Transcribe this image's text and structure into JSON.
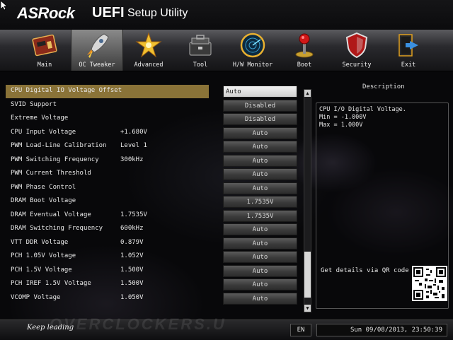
{
  "header": {
    "brand": "ASRock",
    "uefi": "UEFI",
    "title": "Setup Utility"
  },
  "tabs": [
    {
      "label": "Main",
      "icon": "main-board-icon"
    },
    {
      "label": "OC Tweaker",
      "icon": "rocket-icon"
    },
    {
      "label": "Advanced",
      "icon": "star-burst-icon"
    },
    {
      "label": "Tool",
      "icon": "toolbox-icon"
    },
    {
      "label": "H/W Monitor",
      "icon": "radar-icon"
    },
    {
      "label": "Boot",
      "icon": "joystick-icon"
    },
    {
      "label": "Security",
      "icon": "shield-icon"
    },
    {
      "label": "Exit",
      "icon": "exit-door-icon"
    }
  ],
  "active_tab": "OC Tweaker",
  "settings": [
    {
      "label": "CPU Digital IO Voltage Offset",
      "current": "",
      "value": "Auto",
      "selected": true
    },
    {
      "label": "SVID Support",
      "current": "",
      "value": "Disabled"
    },
    {
      "label": "Extreme Voltage",
      "current": "",
      "value": "Disabled"
    },
    {
      "label": "CPU Input Voltage",
      "current": "+1.680V",
      "value": "Auto"
    },
    {
      "label": "PWM Load-Line Calibration",
      "current": "Level 1",
      "value": "Auto"
    },
    {
      "label": "PWM Switching Frequency",
      "current": "300kHz",
      "value": "Auto"
    },
    {
      "label": "PWM Current Threshold",
      "current": "",
      "value": "Auto"
    },
    {
      "label": "PWM Phase Control",
      "current": "",
      "value": "Auto"
    },
    {
      "label": "DRAM Boot Voltage",
      "current": "",
      "value": "1.7535V"
    },
    {
      "label": "DRAM Eventual Voltage",
      "current": "1.7535V",
      "value": "1.7535V"
    },
    {
      "label": "DRAM Switching Frequency",
      "current": "600kHz",
      "value": "Auto"
    },
    {
      "label": "VTT DDR Voltage",
      "current": "0.879V",
      "value": "Auto"
    },
    {
      "label": "PCH 1.05V Voltage",
      "current": "1.052V",
      "value": "Auto"
    },
    {
      "label": "PCH 1.5V Voltage",
      "current": "1.500V",
      "value": "Auto"
    },
    {
      "label": "PCH IREF 1.5V Voltage",
      "current": "1.500V",
      "value": "Auto"
    },
    {
      "label": "VCOMP Voltage",
      "current": "1.050V",
      "value": "Auto"
    }
  ],
  "scrollbar": {
    "up": "▲",
    "down": "▼",
    "thumb_start": 0.74,
    "thumb_end": 0.96
  },
  "description": {
    "title": "Description",
    "lines": [
      "CPU I/O Digital Voltage.",
      "Min = -1.000V",
      "Max = 1.000V"
    ],
    "qr_text": "Get details via QR code"
  },
  "footer": {
    "slogan": "Keep leading",
    "watermark": "OVERCLOCKERS.U",
    "language": "EN",
    "datetime": "Sun 09/08/2013, 23:50:39"
  }
}
